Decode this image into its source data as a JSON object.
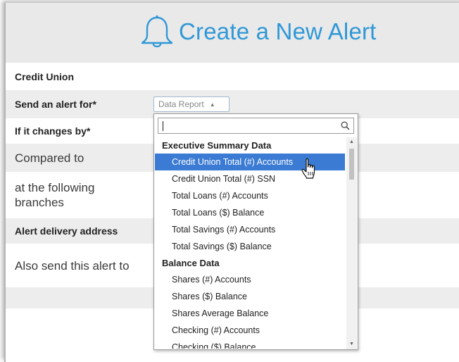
{
  "header": {
    "title": "Create a New Alert",
    "icon": "bell-icon"
  },
  "form": {
    "credit_union_label": "Credit Union",
    "send_alert_label": "Send an alert for*",
    "changes_by_label": "If it changes by*",
    "compared_to_label": "Compared to",
    "branches_label": "at the following branches",
    "delivery_label": "Alert delivery address",
    "also_send_label": "Also send this alert to"
  },
  "select": {
    "value": "Data Report",
    "caret": "▲",
    "search_value": "",
    "groups": [
      {
        "label": "Executive Summary Data",
        "options": [
          "Credit Union Total (#) Accounts",
          "Credit Union Total (#) SSN",
          "Total Loans (#) Accounts",
          "Total Loans ($) Balance",
          "Total Savings (#) Accounts",
          "Total Savings ($) Balance"
        ]
      },
      {
        "label": "Balance Data",
        "options": [
          "Shares (#) Accounts",
          "Shares ($) Balance",
          "Shares Average Balance",
          "Checking (#) Accounts",
          "Checking ($) Balance"
        ]
      }
    ],
    "highlighted": "Credit Union Total (#) Accounts"
  },
  "colors": {
    "accent": "#2f98d6",
    "highlight": "#3b7bd4",
    "row_gray": "#ededed"
  }
}
